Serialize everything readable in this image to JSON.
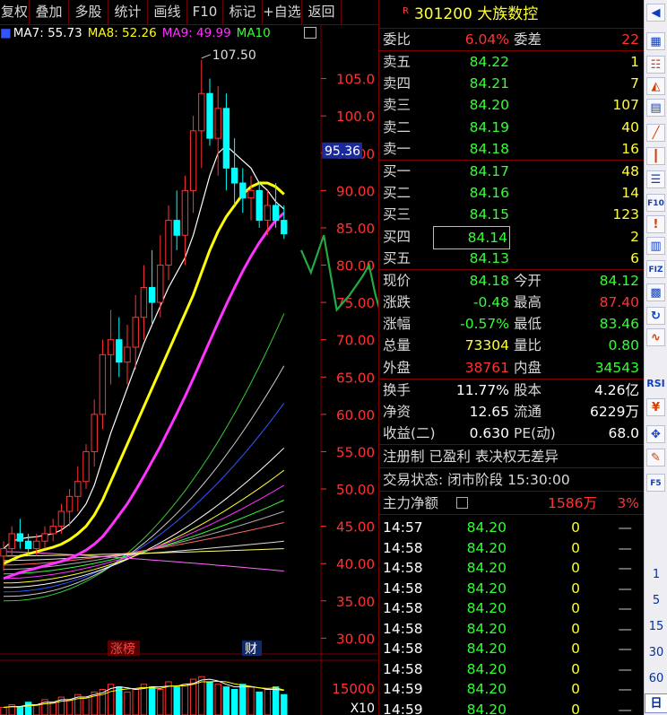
{
  "toolbar": [
    "复权",
    "叠加",
    "多股",
    "统计",
    "画线",
    "F10",
    "标记",
    "+自选",
    "返回"
  ],
  "ma_legend": [
    {
      "label": "MA7: 55.73",
      "color": "#ffffff"
    },
    {
      "label": "MA8: 52.26",
      "color": "#ffff00"
    },
    {
      "label": "MA9: 49.99",
      "color": "#ff33ff"
    },
    {
      "label": "MA10",
      "color": "#33ff33"
    }
  ],
  "chart": {
    "high_label": "107.50",
    "crosshair_price": "95.36",
    "price_ticks": [
      "105.0",
      "100.0",
      "95.00",
      "90.00",
      "85.00",
      "80.00",
      "75.00",
      "70.00",
      "65.00",
      "60.00",
      "55.00",
      "50.00",
      "45.00",
      "40.00",
      "35.00",
      "30.00"
    ],
    "markers": [
      "涨榜",
      "财"
    ],
    "vol_tick": "15000",
    "vol_unit": "X10",
    "colors": {
      "up": "#ff3333",
      "down": "#00ffff",
      "grid": "#7a0000",
      "axis_text": "#ff3333"
    }
  },
  "chart_data": {
    "type": "candlestick",
    "ylim": [
      28,
      110
    ],
    "candles": [
      [
        41,
        43,
        39,
        42
      ],
      [
        42,
        45,
        41,
        44
      ],
      [
        44,
        46,
        42,
        43
      ],
      [
        43,
        44,
        41,
        42
      ],
      [
        42,
        44,
        41,
        43
      ],
      [
        43,
        45,
        42,
        44
      ],
      [
        44,
        46,
        43,
        45
      ],
      [
        45,
        48,
        44,
        47
      ],
      [
        47,
        50,
        45,
        49
      ],
      [
        49,
        53,
        47,
        51
      ],
      [
        51,
        56,
        50,
        55
      ],
      [
        55,
        62,
        53,
        60
      ],
      [
        60,
        70,
        58,
        68
      ],
      [
        68,
        74,
        64,
        70
      ],
      [
        70,
        73,
        65,
        67
      ],
      [
        67,
        72,
        64,
        69
      ],
      [
        69,
        76,
        66,
        73
      ],
      [
        73,
        80,
        70,
        77
      ],
      [
        77,
        82,
        72,
        75
      ],
      [
        75,
        84,
        73,
        80
      ],
      [
        80,
        88,
        78,
        86
      ],
      [
        86,
        90,
        82,
        84
      ],
      [
        84,
        92,
        80,
        90
      ],
      [
        90,
        100,
        87,
        98
      ],
      [
        98,
        107.5,
        93,
        103
      ],
      [
        103,
        105,
        96,
        97
      ],
      [
        97,
        104,
        92,
        101
      ],
      [
        101,
        103,
        90,
        93
      ],
      [
        93,
        97,
        88,
        91
      ],
      [
        91,
        93,
        87,
        89
      ],
      [
        89,
        92,
        86,
        90
      ],
      [
        90,
        91,
        85,
        86
      ],
      [
        86,
        90,
        84,
        88
      ],
      [
        88,
        91,
        85,
        86
      ],
      [
        86,
        88,
        83.5,
        84.2
      ]
    ],
    "ma_lines": [
      {
        "name": "MA7",
        "color": "#ffffff",
        "width": 1.2,
        "values": [
          42,
          43,
          43.3,
          43.5,
          43.6,
          43.8,
          44,
          44.5,
          45.3,
          46.5,
          48,
          50.5,
          54,
          57.5,
          60.5,
          63.5,
          66.5,
          69.5,
          72,
          74.5,
          77,
          79,
          81,
          84,
          88,
          92,
          95,
          96,
          95,
          94,
          93,
          91,
          90,
          88.5,
          87.5
        ]
      },
      {
        "name": "MA8",
        "color": "#ffff00",
        "width": 3,
        "values": [
          40,
          40.5,
          41,
          41.3,
          41.6,
          41.9,
          42.2,
          42.6,
          43.2,
          44,
          45,
          46.5,
          48.5,
          51,
          53.5,
          56,
          58.5,
          61,
          63.5,
          66,
          68.5,
          71,
          73.5,
          76,
          79,
          82,
          84.5,
          86.5,
          88,
          89.5,
          90.5,
          91,
          91,
          90.5,
          89.5
        ]
      },
      {
        "name": "MA9",
        "color": "#ff33ff",
        "width": 3,
        "values": [
          38,
          38.4,
          38.8,
          39.1,
          39.4,
          39.7,
          40,
          40.3,
          40.7,
          41.2,
          41.8,
          42.6,
          43.6,
          45,
          46.5,
          48,
          49.8,
          51.7,
          53.7,
          55.7,
          57.9,
          60.1,
          62.4,
          64.8,
          67.3,
          69.8,
          72.3,
          74.7,
          77,
          79.2,
          81.2,
          83,
          84.6,
          86,
          87
        ]
      }
    ],
    "ma_fan": [
      {
        "color": "#33cc33",
        "end": 73.5
      },
      {
        "color": "#cccccc",
        "end": 66.5
      },
      {
        "color": "#3355ff",
        "end": 61.5
      },
      {
        "color": "#ffffff",
        "end": 55.5
      },
      {
        "color": "#ffff33",
        "end": 52.5
      },
      {
        "color": "#ff33ff",
        "end": 50.5
      },
      {
        "color": "#33ff33",
        "end": 48.5
      },
      {
        "color": "#aaaaaa",
        "end": 47
      },
      {
        "color": "#ff6666",
        "end": 45.5
      },
      {
        "color": "#dddddd",
        "end": 43
      },
      {
        "color": "#ffff66",
        "end": 42
      },
      {
        "color": "#ff66ff",
        "end": 39
      }
    ],
    "projection": [
      [
        84.5,
        82
      ],
      [
        86,
        79
      ],
      [
        88,
        84
      ],
      [
        90,
        74
      ],
      [
        92,
        76
      ],
      [
        94,
        78.5
      ],
      [
        95,
        80
      ],
      [
        96,
        76
      ],
      [
        97,
        73
      ],
      [
        98,
        70
      ],
      [
        99,
        68
      ],
      [
        100,
        72
      ],
      [
        101,
        74
      ],
      [
        102,
        70
      ],
      [
        103,
        65
      ],
      [
        104,
        60
      ],
      [
        105,
        55
      ]
    ],
    "volume": [
      3,
      4,
      3,
      5,
      4,
      6,
      5,
      7,
      6,
      8,
      7,
      9,
      10,
      12,
      11,
      9,
      10,
      12,
      11,
      10,
      13,
      11,
      12,
      14,
      15,
      13,
      12,
      11,
      10,
      12,
      11,
      9,
      10,
      11,
      8
    ]
  },
  "quote": {
    "badge": "R",
    "code": "301200",
    "name": "大族数控",
    "weibi": {
      "label": "委比",
      "value": "6.04%",
      "label2": "委差",
      "value2": "22"
    },
    "sell": [
      {
        "label": "卖五",
        "price": "84.22",
        "vol": "1"
      },
      {
        "label": "卖四",
        "price": "84.21",
        "vol": "7"
      },
      {
        "label": "卖三",
        "price": "84.20",
        "vol": "107"
      },
      {
        "label": "卖二",
        "price": "84.19",
        "vol": "40"
      },
      {
        "label": "卖一",
        "price": "84.18",
        "vol": "16"
      }
    ],
    "buy": [
      {
        "label": "买一",
        "price": "84.17",
        "vol": "48"
      },
      {
        "label": "买二",
        "price": "84.16",
        "vol": "14"
      },
      {
        "label": "买三",
        "price": "84.15",
        "vol": "123"
      },
      {
        "label": "买四",
        "price": "84.14",
        "vol": "2"
      },
      {
        "label": "买五",
        "price": "84.13",
        "vol": "6"
      }
    ],
    "stats": [
      {
        "l1": "现价",
        "v1": "84.18",
        "c1": "#33ff33",
        "l2": "今开",
        "v2": "84.12",
        "c2": "#33ff33"
      },
      {
        "l1": "涨跌",
        "v1": "-0.48",
        "c1": "#33ff33",
        "l2": "最高",
        "v2": "87.40",
        "c2": "#ff3333"
      },
      {
        "l1": "涨幅",
        "v1": "-0.57%",
        "c1": "#33ff33",
        "l2": "最低",
        "v2": "83.46",
        "c2": "#33ff33"
      },
      {
        "l1": "总量",
        "v1": "73304",
        "c1": "#ffff33",
        "l2": "量比",
        "v2": "0.80",
        "c2": "#33ff33"
      },
      {
        "l1": "外盘",
        "v1": "38761",
        "c1": "#ff3333",
        "l2": "内盘",
        "v2": "34543",
        "c2": "#33ff33"
      }
    ],
    "fund": [
      {
        "l1": "换手",
        "v1": "11.77%",
        "l2": "股本",
        "v2": "4.26亿"
      },
      {
        "l1": "净资",
        "v1": "12.65",
        "l2": "流通",
        "v2": "6229万"
      },
      {
        "l1": "收益(二)",
        "v1": "0.630",
        "l2": "PE(动)",
        "v2": "68.0"
      }
    ],
    "tags": "注册制 已盈利 表决权无差异",
    "status": "交易状态: 闭市阶段 15:30:00",
    "main_fund": {
      "label": "主力净额",
      "value": "1586万",
      "pct": "3%"
    },
    "ticks": [
      {
        "time": "14:57",
        "price": "84.20",
        "vol": "0",
        "flag": "—"
      },
      {
        "time": "14:58",
        "price": "84.20",
        "vol": "0",
        "flag": "—"
      },
      {
        "time": "14:58",
        "price": "84.20",
        "vol": "0",
        "flag": "—"
      },
      {
        "time": "14:58",
        "price": "84.20",
        "vol": "0",
        "flag": "—"
      },
      {
        "time": "14:58",
        "price": "84.20",
        "vol": "0",
        "flag": "—"
      },
      {
        "time": "14:58",
        "price": "84.20",
        "vol": "0",
        "flag": "—"
      },
      {
        "time": "14:58",
        "price": "84.20",
        "vol": "0",
        "flag": "—"
      },
      {
        "time": "14:58",
        "price": "84.20",
        "vol": "0",
        "flag": "—"
      },
      {
        "time": "14:59",
        "price": "84.20",
        "vol": "0",
        "flag": "—"
      },
      {
        "time": "14:59",
        "price": "84.20",
        "vol": "0",
        "flag": "—"
      }
    ]
  },
  "sidebar": {
    "icons": [
      "chevron-left-icon",
      "grid-icon",
      "ladder-icon",
      "triangle-icon",
      "tile-icon",
      "line-chart-icon",
      "candle-icon",
      "doc-icon",
      "f10-icon",
      "exclaim-icon",
      "book-icon",
      "fiz-icon",
      "bar-icon",
      "refresh-icon",
      "wave-icon",
      "rsi-icon",
      "money-icon",
      "move-icon",
      "pen-icon",
      "f5-icon"
    ],
    "rsi": "RSI",
    "periods": [
      "1",
      "5",
      "15",
      "30",
      "60"
    ],
    "day": "日"
  }
}
